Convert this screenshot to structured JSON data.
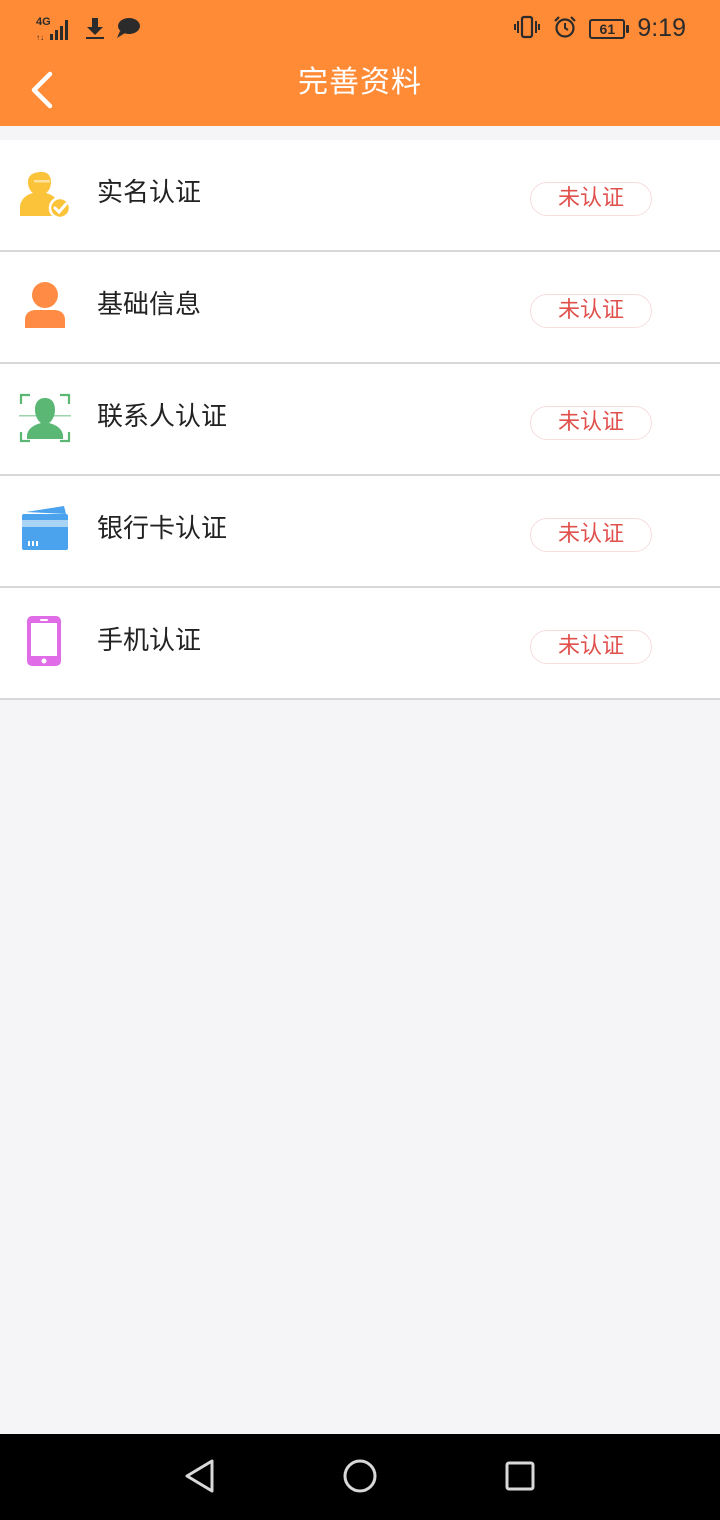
{
  "status_bar": {
    "network": "4G",
    "battery": "61",
    "time": "9:19",
    "icons": [
      "signal-icon",
      "download-icon",
      "message-icon",
      "vibrate-icon",
      "alarm-icon",
      "battery-icon"
    ]
  },
  "header": {
    "title": "完善资料",
    "back_icon": "chevron-left-icon",
    "background": "#ff8b37"
  },
  "items": [
    {
      "label": "实名认证",
      "status": "未认证",
      "icon": "id-verified-user-icon",
      "icon_color": "#fbc33a"
    },
    {
      "label": "基础信息",
      "status": "未认证",
      "icon": "person-icon",
      "icon_color": "#ff8b45"
    },
    {
      "label": "联系人认证",
      "status": "未认证",
      "icon": "face-scan-icon",
      "icon_color": "#5ab874"
    },
    {
      "label": "银行卡认证",
      "status": "未认证",
      "icon": "bank-card-icon",
      "icon_color": "#4aa3ec"
    },
    {
      "label": "手机认证",
      "status": "未认证",
      "icon": "mobile-phone-icon",
      "icon_color": "#e16ce8"
    }
  ],
  "status_color": "#e0504c",
  "nav": {
    "icons": [
      "back-triangle-icon",
      "home-circle-icon",
      "recents-square-icon"
    ]
  }
}
